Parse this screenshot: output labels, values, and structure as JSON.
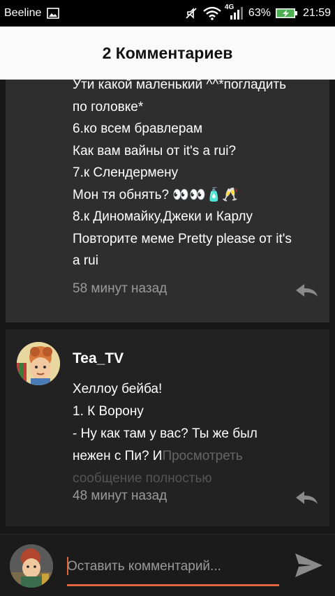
{
  "status_bar": {
    "carrier": "Beeline",
    "network": "4G",
    "battery": "63%",
    "time": "21:59"
  },
  "header": {
    "title": "2 Комментариев"
  },
  "comments": [
    {
      "lines": [
        "Ути какой маленький ^^*погладить",
        "по головке*",
        "6.ко всем бравлерам",
        "Как вам вайны от it's a rui?",
        "7.к Слендермену",
        "Мон тя обнять? 👀👀🧴🥂",
        "8.к Диномайку,Джеки и Карлу",
        "Повторите меме Pretty please от it's",
        "a rui"
      ],
      "time": "58 минут назад"
    },
    {
      "username": "Tea_TV",
      "lines": [
        "Хеллоу бейба!",
        "1. К Ворону",
        "- Ну как там у вас? Ты же был"
      ],
      "line_partial": "нежен с  Пи? И",
      "more_label_a": "Просмотреть",
      "more_label_b": "сообщение полностью",
      "time": "48 минут назад"
    }
  ],
  "comment_input": {
    "placeholder": "Оставить комментарий..."
  },
  "icons": {
    "reply": "reply-icon",
    "send": "send-icon",
    "image": "image-icon",
    "wifi": "wifi-icon",
    "signal": "signal-icon",
    "battery": "battery-icon",
    "mute": "mute-icon"
  },
  "colors": {
    "accent": "#e0643c",
    "battery": "#4caf50"
  }
}
